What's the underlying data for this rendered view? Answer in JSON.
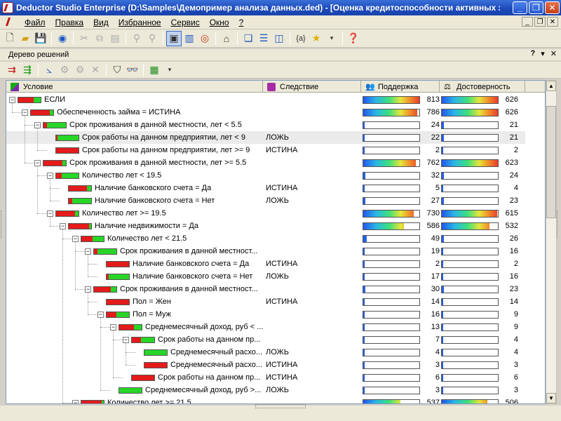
{
  "window": {
    "title": "Deductor Studio Enterprise (D:\\Samples\\Демопример анализа данных.ded) - [Оценка кредитоспособности активных зае..."
  },
  "menu": [
    "Файл",
    "Правка",
    "Вид",
    "Избранное",
    "Сервис",
    "Окно",
    "?"
  ],
  "panel": {
    "title": "Дерево решений",
    "controls": [
      "?",
      "▾",
      "✕"
    ]
  },
  "columns": {
    "condition": "Условие",
    "consequence": "Следствие",
    "support": "Поддержка",
    "confidence": "Достоверность"
  },
  "rows": [
    {
      "level": 0,
      "text": "ЕСЛИ",
      "cons": "",
      "sup": 813,
      "conf": 626,
      "red": 0.7,
      "expander": "−"
    },
    {
      "level": 1,
      "text": "Обеспеченность займа = ИСТИНА",
      "cons": "",
      "sup": 786,
      "conf": 626,
      "red": 0.85,
      "expander": "−"
    },
    {
      "level": 2,
      "text": "Срок проживания в данной местности, лет < 5.5",
      "cons": "",
      "sup": 24,
      "conf": 21,
      "red": 0.15,
      "expander": "−"
    },
    {
      "level": 3,
      "text": "Срок работы на данном предприятии, лет < 9",
      "cons": "ЛОЖЬ",
      "sup": 22,
      "conf": 21,
      "red": 0.05,
      "expander": "",
      "selected": true
    },
    {
      "level": 3,
      "text": "Срок работы на данном предприятии, лет >= 9",
      "cons": "ИСТИНА",
      "sup": 2,
      "conf": 2,
      "red": 1.0,
      "expander": ""
    },
    {
      "level": 2,
      "text": "Срок проживания в данной местности, лет >= 5.5",
      "cons": "",
      "sup": 762,
      "conf": 623,
      "red": 0.85,
      "expander": "−"
    },
    {
      "level": 3,
      "text": "Количество лет < 19.5",
      "cons": "",
      "sup": 32,
      "conf": 24,
      "red": 0.25,
      "expander": "−"
    },
    {
      "level": 4,
      "text": "Наличие банковского счета = Да",
      "cons": "ИСТИНА",
      "sup": 5,
      "conf": 4,
      "red": 0.8,
      "expander": ""
    },
    {
      "level": 4,
      "text": "Наличие банковского счета = Нет",
      "cons": "ЛОЖЬ",
      "sup": 27,
      "conf": 23,
      "red": 0.15,
      "expander": ""
    },
    {
      "level": 3,
      "text": "Количество лет >= 19.5",
      "cons": "",
      "sup": 730,
      "conf": 615,
      "red": 0.85,
      "expander": "−"
    },
    {
      "level": 4,
      "text": "Наличие недвижимости = Да",
      "cons": "",
      "sup": 586,
      "conf": 532,
      "red": 0.9,
      "expander": "−"
    },
    {
      "level": 5,
      "text": "Количество лет < 21.5",
      "cons": "",
      "sup": 49,
      "conf": 26,
      "red": 0.5,
      "expander": "−"
    },
    {
      "level": 6,
      "text": "Срок проживания в данной местност...",
      "cons": "",
      "sup": 19,
      "conf": 16,
      "red": 0.15,
      "expander": "−"
    },
    {
      "level": 7,
      "text": "Наличие банковского счета = Да",
      "cons": "ИСТИНА",
      "sup": 2,
      "conf": 2,
      "red": 1.0,
      "expander": ""
    },
    {
      "level": 7,
      "text": "Наличие банковского счета = Нет",
      "cons": "ЛОЖЬ",
      "sup": 17,
      "conf": 16,
      "red": 0.1,
      "expander": ""
    },
    {
      "level": 6,
      "text": "Срок проживания в данной местност...",
      "cons": "",
      "sup": 30,
      "conf": 23,
      "red": 0.75,
      "expander": "−"
    },
    {
      "level": 7,
      "text": "Пол = Жен",
      "cons": "ИСТИНА",
      "sup": 14,
      "conf": 14,
      "red": 1.0,
      "expander": ""
    },
    {
      "level": 7,
      "text": "Пол = Муж",
      "cons": "",
      "sup": 16,
      "conf": 9,
      "red": 0.45,
      "expander": "−"
    },
    {
      "level": 8,
      "text": "Среднемесячный доход, руб < ...",
      "cons": "",
      "sup": 13,
      "conf": 9,
      "red": 0.65,
      "expander": "−"
    },
    {
      "level": 9,
      "text": "Срок работы на данном пр...",
      "cons": "",
      "sup": 7,
      "conf": 4,
      "red": 0.4,
      "expander": "−"
    },
    {
      "level": 10,
      "text": "Среднемесячный расхо...",
      "cons": "ЛОЖЬ",
      "sup": 4,
      "conf": 4,
      "red": 0.0,
      "expander": ""
    },
    {
      "level": 10,
      "text": "Среднемесячный расхо...",
      "cons": "ИСТИНА",
      "sup": 3,
      "conf": 3,
      "red": 1.0,
      "expander": ""
    },
    {
      "level": 9,
      "text": "Срок работы на данном пр...",
      "cons": "ИСТИНА",
      "sup": 6,
      "conf": 6,
      "red": 1.0,
      "expander": ""
    },
    {
      "level": 8,
      "text": "Среднемесячный доход, руб >...",
      "cons": "ЛОЖЬ",
      "sup": 3,
      "conf": 3,
      "red": 0.0,
      "expander": ""
    },
    {
      "level": 5,
      "text": "Количество лет >= 21.5",
      "cons": "",
      "sup": 537,
      "conf": 506,
      "red": 0.9,
      "expander": "−"
    }
  ],
  "max": {
    "sup": 813,
    "conf": 626
  }
}
